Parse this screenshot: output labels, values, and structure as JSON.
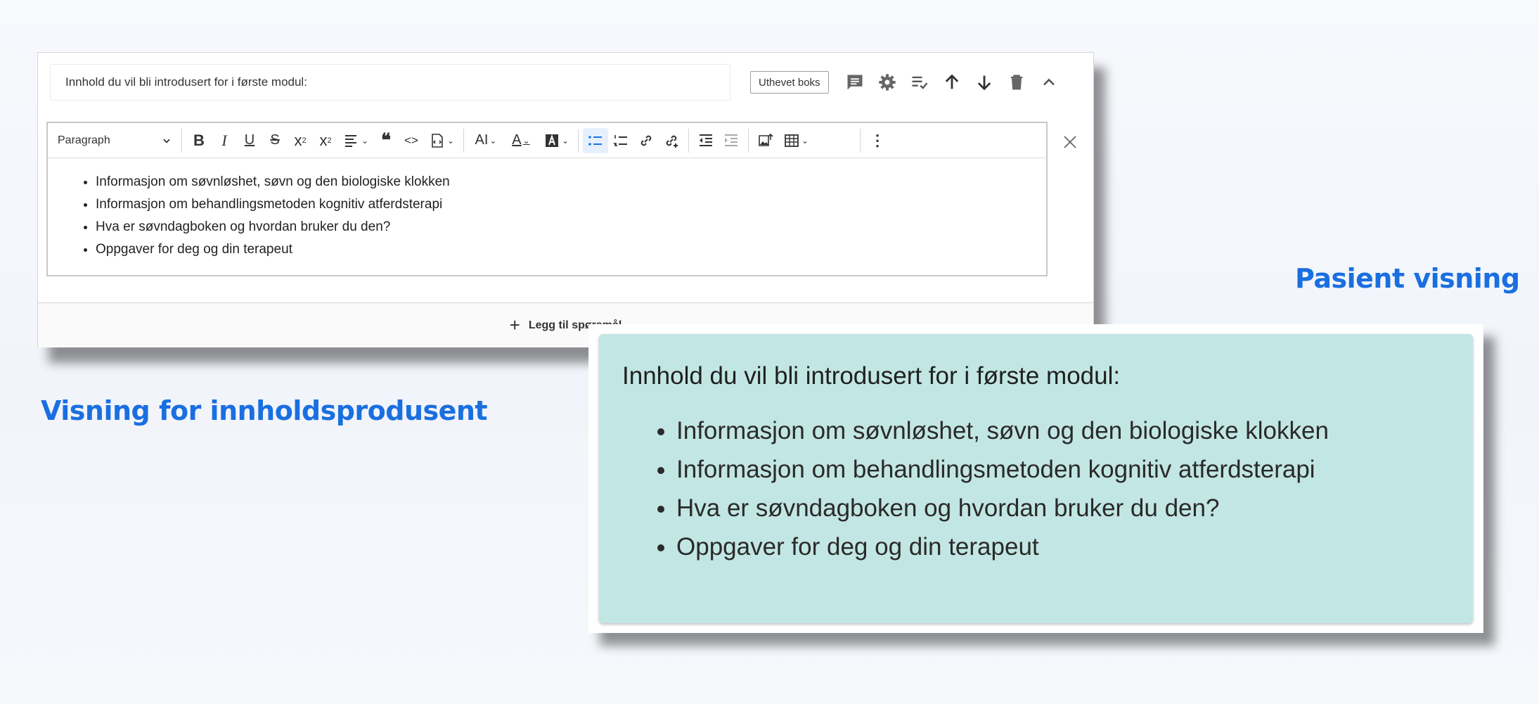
{
  "editor": {
    "title_value": "Innhold du vil bli introdusert for i første modul:",
    "tag_button": "Uthevet boks",
    "paragraph_style": "Paragraph",
    "items": [
      "Informasjon om søvnløshet, søvn og den biologiske klokken",
      "Informasjon om behandlingsmetoden kognitiv atferdsterapi",
      "Hva er søvndagboken og hvordan bruker du den?",
      "Oppgaver for deg og din terapeut"
    ],
    "add_question": "Legg til spørsmål"
  },
  "labels": {
    "producer_view": "Visning for innholdsprodusent",
    "patient_view": "Pasient visning"
  },
  "patient": {
    "heading": "Innhold du vil bli introdusert for i første modul:",
    "items": [
      "Informasjon om søvnløshet, søvn og den biologiske klokken",
      "Informasjon om behandlingsmetoden kognitiv atferdsterapi",
      "Hva er søvndagboken og hvordan bruker du den?",
      "Oppgaver for deg og din terapeut"
    ]
  },
  "colors": {
    "accent_blue": "#1a6fe0",
    "patient_bg": "#c2e6e3"
  },
  "icons": [
    "comment-icon",
    "gear-icon",
    "checklist-icon",
    "arrow-up-icon",
    "arrow-down-icon",
    "trash-icon",
    "chevron-up-icon",
    "close-icon"
  ]
}
